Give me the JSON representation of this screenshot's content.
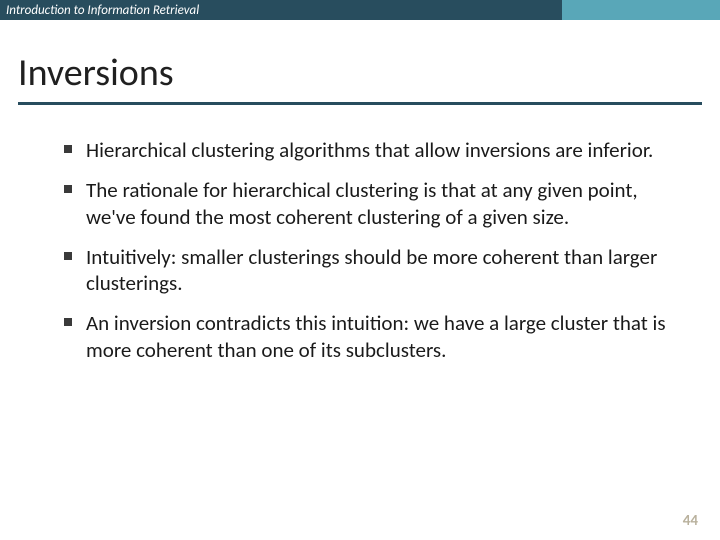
{
  "header": {
    "course_title": "Introduction to Information Retrieval"
  },
  "slide": {
    "title": "Inversions",
    "bullets": [
      "Hierarchical clustering algorithms that allow inversions are inferior.",
      "The rationale for hierarchical clustering is that at any given point, we've found the most coherent clustering of a given size.",
      "Intuitively: smaller clusterings should be more coherent than larger clusterings.",
      "An inversion contradicts this intuition: we have a large cluster that is more coherent than one of its subclusters."
    ],
    "page_number": "44"
  }
}
